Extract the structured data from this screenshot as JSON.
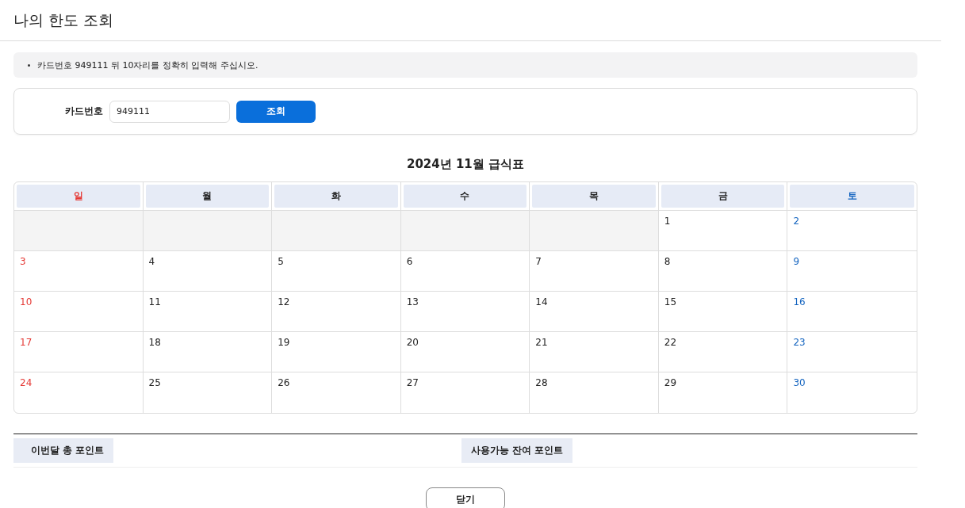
{
  "page_title": "나의 한도 조회",
  "notice": "카드번호 949111 뒤 10자리를 정확히 입력해 주십시오.",
  "form": {
    "label": "카드번호",
    "value": "949111",
    "button": "조회"
  },
  "calendar": {
    "title": "2024년 11월 급식표",
    "weekdays": [
      {
        "label": "일",
        "color": "#e53935"
      },
      {
        "label": "월",
        "color": "#222222"
      },
      {
        "label": "화",
        "color": "#222222"
      },
      {
        "label": "수",
        "color": "#222222"
      },
      {
        "label": "목",
        "color": "#222222"
      },
      {
        "label": "금",
        "color": "#222222"
      },
      {
        "label": "토",
        "color": "#1565c0"
      }
    ],
    "weeks": [
      [
        {
          "kind": "blank"
        },
        {
          "kind": "blank"
        },
        {
          "kind": "blank"
        },
        {
          "kind": "blank"
        },
        {
          "kind": "blank"
        },
        {
          "kind": "day",
          "day": "1"
        },
        {
          "kind": "day",
          "day": "2"
        }
      ],
      [
        {
          "kind": "day",
          "day": "3"
        },
        {
          "kind": "day",
          "day": "4"
        },
        {
          "kind": "day",
          "day": "5"
        },
        {
          "kind": "day",
          "day": "6"
        },
        {
          "kind": "day",
          "day": "7"
        },
        {
          "kind": "day",
          "day": "8"
        },
        {
          "kind": "day",
          "day": "9"
        }
      ],
      [
        {
          "kind": "day",
          "day": "10"
        },
        {
          "kind": "day",
          "day": "11"
        },
        {
          "kind": "day",
          "day": "12"
        },
        {
          "kind": "day",
          "day": "13"
        },
        {
          "kind": "day",
          "day": "14"
        },
        {
          "kind": "day",
          "day": "15"
        },
        {
          "kind": "day",
          "day": "16"
        }
      ],
      [
        {
          "kind": "day",
          "day": "17"
        },
        {
          "kind": "day",
          "day": "18"
        },
        {
          "kind": "day",
          "day": "19"
        },
        {
          "kind": "day",
          "day": "20"
        },
        {
          "kind": "day",
          "day": "21"
        },
        {
          "kind": "day",
          "day": "22"
        },
        {
          "kind": "day",
          "day": "23"
        }
      ],
      [
        {
          "kind": "day",
          "day": "24"
        },
        {
          "kind": "day",
          "day": "25"
        },
        {
          "kind": "day",
          "day": "26"
        },
        {
          "kind": "day",
          "day": "27"
        },
        {
          "kind": "day",
          "day": "28"
        },
        {
          "kind": "day",
          "day": "29"
        },
        {
          "kind": "day",
          "day": "30"
        }
      ]
    ]
  },
  "points": [
    "이번달 총 포인트",
    "사용가능 잔여 포인트"
  ],
  "close_button": "닫기"
}
